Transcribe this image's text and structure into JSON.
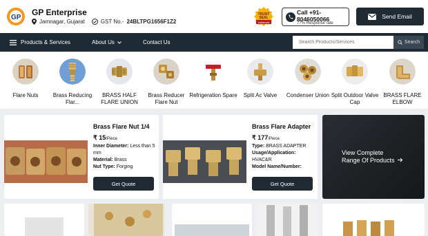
{
  "brand": {
    "name": "GP Enterprise",
    "location": "Jamnagar, Gujarat",
    "gst_label": "GST No.-",
    "gst_number": "24BLTPG1656F1Z2",
    "trust_seal": "TRUST SEAL indiamart"
  },
  "contact": {
    "call_label": "Call +91-8046050066",
    "response_rate": "77% Response rate",
    "send_email": "Send Email"
  },
  "nav": {
    "products_services": "Products & Services",
    "about_us": "About Us",
    "contact_us": "Contact Us",
    "search_placeholder": "Search Products/Services",
    "search_button": "Search"
  },
  "categories": [
    {
      "label": "Flare Nuts",
      "icon": "flare-nut-icon"
    },
    {
      "label": "Brass Reducing Flar...",
      "icon": "brass-reducing-icon"
    },
    {
      "label": "BRASS HALF FLARE UNION",
      "icon": "brass-half-flare-icon"
    },
    {
      "label": "Brass Reducer Flare Nut",
      "icon": "brass-reducer-icon"
    },
    {
      "label": "Refrigeration Spare",
      "icon": "refrigeration-spare-icon"
    },
    {
      "label": "Split Ac Valve",
      "icon": "split-ac-valve-icon"
    },
    {
      "label": "Condenser Union",
      "icon": "condenser-union-icon"
    },
    {
      "label": "Split Outdoor Valve Cap",
      "icon": "outdoor-valve-cap-icon"
    },
    {
      "label": "BRASS FLARE ELBOW",
      "icon": "brass-flare-elbow-icon"
    }
  ],
  "products": [
    {
      "title": "Brass Flare Nut 1/4",
      "price": "₹ 15",
      "unit": "/Piece",
      "spec1_key": "Inner Diameter:",
      "spec1_val": "Less than 5 mm",
      "spec2_key": "Material:",
      "spec2_val": "Brass",
      "spec3_key": "Nut Type:",
      "spec3_val": "Forging",
      "button": "Get Quote"
    },
    {
      "title": "Brass Flare Adapter",
      "price": "₹ 177",
      "unit": "/Piece",
      "spec1_key": "Type:",
      "spec1_val": "BRASS ADAPTER",
      "spec2_key": "Usage/Application:",
      "spec2_val": "HVAC&R",
      "spec3_key": "Model Name/Number:",
      "spec3_val": "",
      "button": "Get Quote"
    }
  ],
  "view_complete": "View Complete Range Of Products",
  "colors": {
    "nav_bg": "#1e2a33",
    "brass": "#c9953f",
    "page_bg": "#eceef1"
  }
}
